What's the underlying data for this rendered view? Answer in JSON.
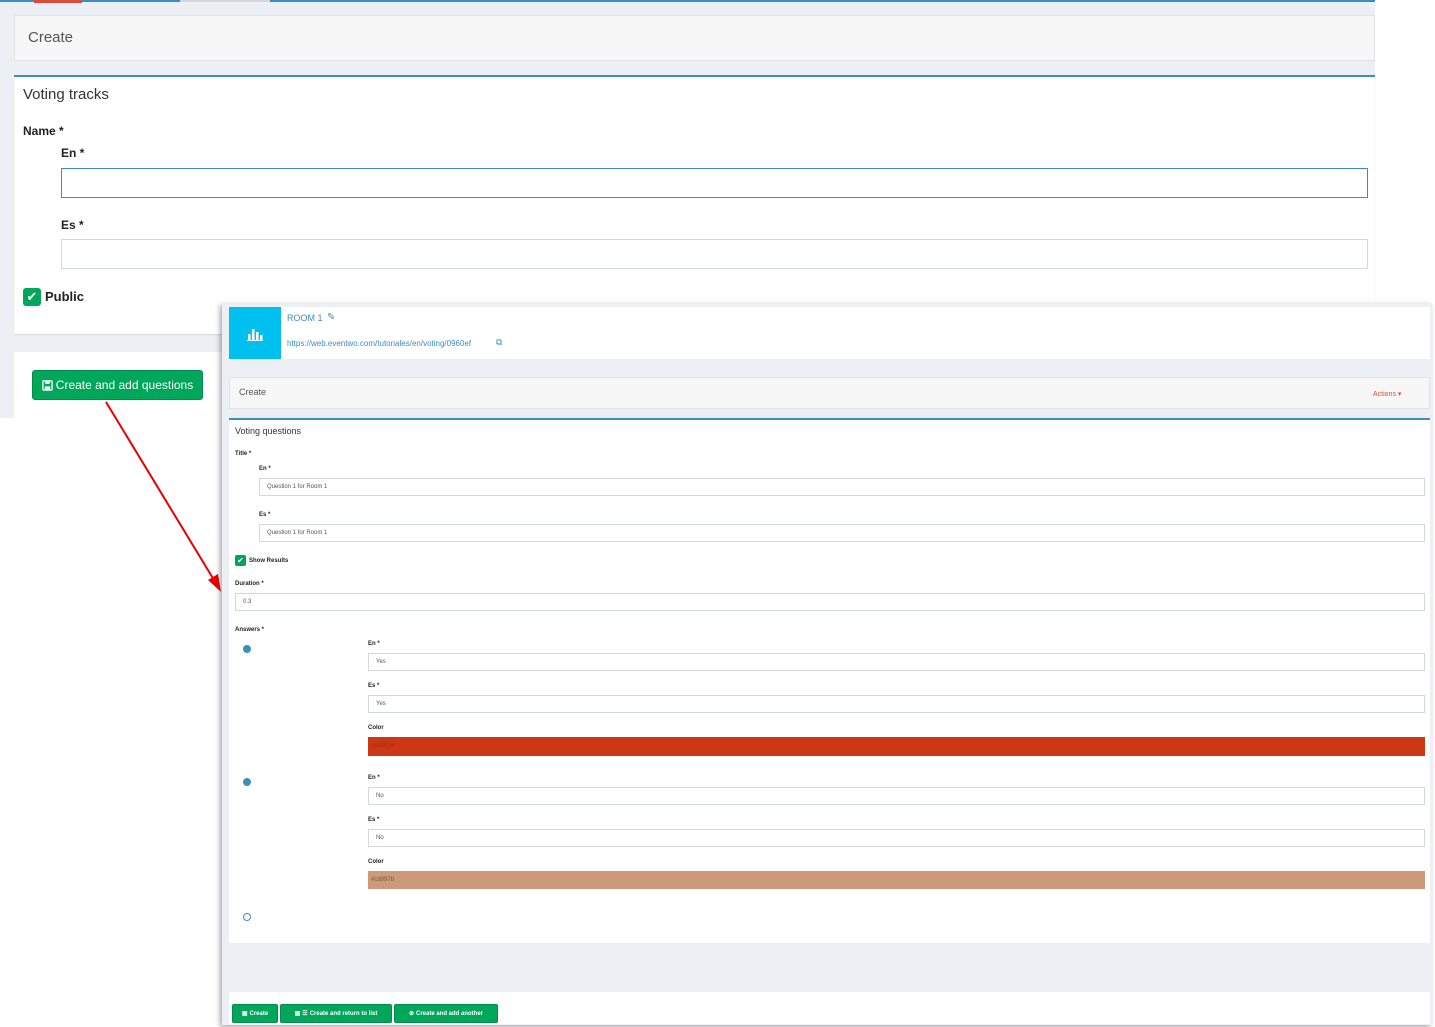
{
  "background": {
    "create_title": "Create",
    "form_title": "Voting tracks",
    "name_label": "Name *",
    "en_label": "En *",
    "es_label": "Es *",
    "en_value": "",
    "es_value": "",
    "public_label": "Public",
    "public_checked": true,
    "create_questions_button": "Create and add questions"
  },
  "overlay": {
    "room_name": "ROOM 1",
    "url": "https://web.eventwo.com/tutoriales/en/voting/0960ef",
    "create_title": "Create",
    "actions_label": "Actions",
    "form_title": "Voting questions",
    "title_label": "Title *",
    "title_en_label": "En *",
    "title_en_value": "Question 1 for Room 1",
    "title_es_label": "Es *",
    "title_es_value": "Question 1 for Room 1",
    "show_results_label": "Show Results",
    "show_results_checked": true,
    "duration_label": "Duration *",
    "duration_value": "0.3",
    "answers_label": "Answers *",
    "answers": [
      {
        "en_label": "En *",
        "en_value": "Yes",
        "es_label": "Es *",
        "es_value": "Yes",
        "color_label": "Color",
        "color_value": "#cd3814"
      },
      {
        "en_label": "En *",
        "en_value": "No",
        "es_label": "Es *",
        "es_value": "No",
        "color_label": "Color",
        "color_value": "#cd997b"
      }
    ],
    "buttons": {
      "create": "Create",
      "create_return": "Create and return to list",
      "create_another": "Create and add another"
    }
  },
  "colors": {
    "primary": "#3c8dbc",
    "success": "#00a65a",
    "info": "#00c0ef",
    "danger": "#dd4b39",
    "arrow": "#e60000"
  }
}
